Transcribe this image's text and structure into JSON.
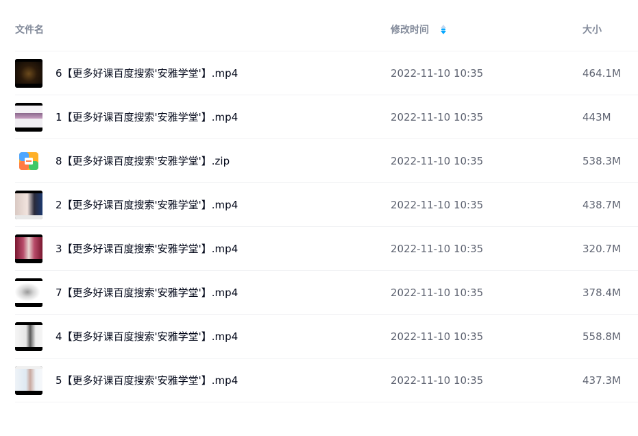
{
  "columns": {
    "name": "文件名",
    "modified": "修改时间",
    "size": "大小"
  },
  "sort": {
    "column": "modified",
    "direction": "descending",
    "icon": "sort-arrows-icon",
    "active_color": "#06a7ff",
    "inactive_color": "#c4d8f0"
  },
  "files": [
    {
      "name": "6【更多好课百度搜索'安雅学堂'】.mp4",
      "modified": "2022-11-10 10:35",
      "size": "464.1M",
      "type": "video"
    },
    {
      "name": "1【更多好课百度搜索'安雅学堂'】.mp4",
      "modified": "2022-11-10 10:35",
      "size": "443M",
      "type": "video"
    },
    {
      "name": "8【更多好课百度搜索'安雅学堂'】.zip",
      "modified": "2022-11-10 10:35",
      "size": "538.3M",
      "type": "zip"
    },
    {
      "name": "2【更多好课百度搜索'安雅学堂'】.mp4",
      "modified": "2022-11-10 10:35",
      "size": "438.7M",
      "type": "video"
    },
    {
      "name": "3【更多好课百度搜索'安雅学堂'】.mp4",
      "modified": "2022-11-10 10:35",
      "size": "320.7M",
      "type": "video"
    },
    {
      "name": "7【更多好课百度搜索'安雅学堂'】.mp4",
      "modified": "2022-11-10 10:35",
      "size": "378.4M",
      "type": "video"
    },
    {
      "name": "4【更多好课百度搜索'安雅学堂'】.mp4",
      "modified": "2022-11-10 10:35",
      "size": "558.8M",
      "type": "video"
    },
    {
      "name": "5【更多好课百度搜索'安雅学堂'】.mp4",
      "modified": "2022-11-10 10:35",
      "size": "437.3M",
      "type": "video"
    }
  ]
}
